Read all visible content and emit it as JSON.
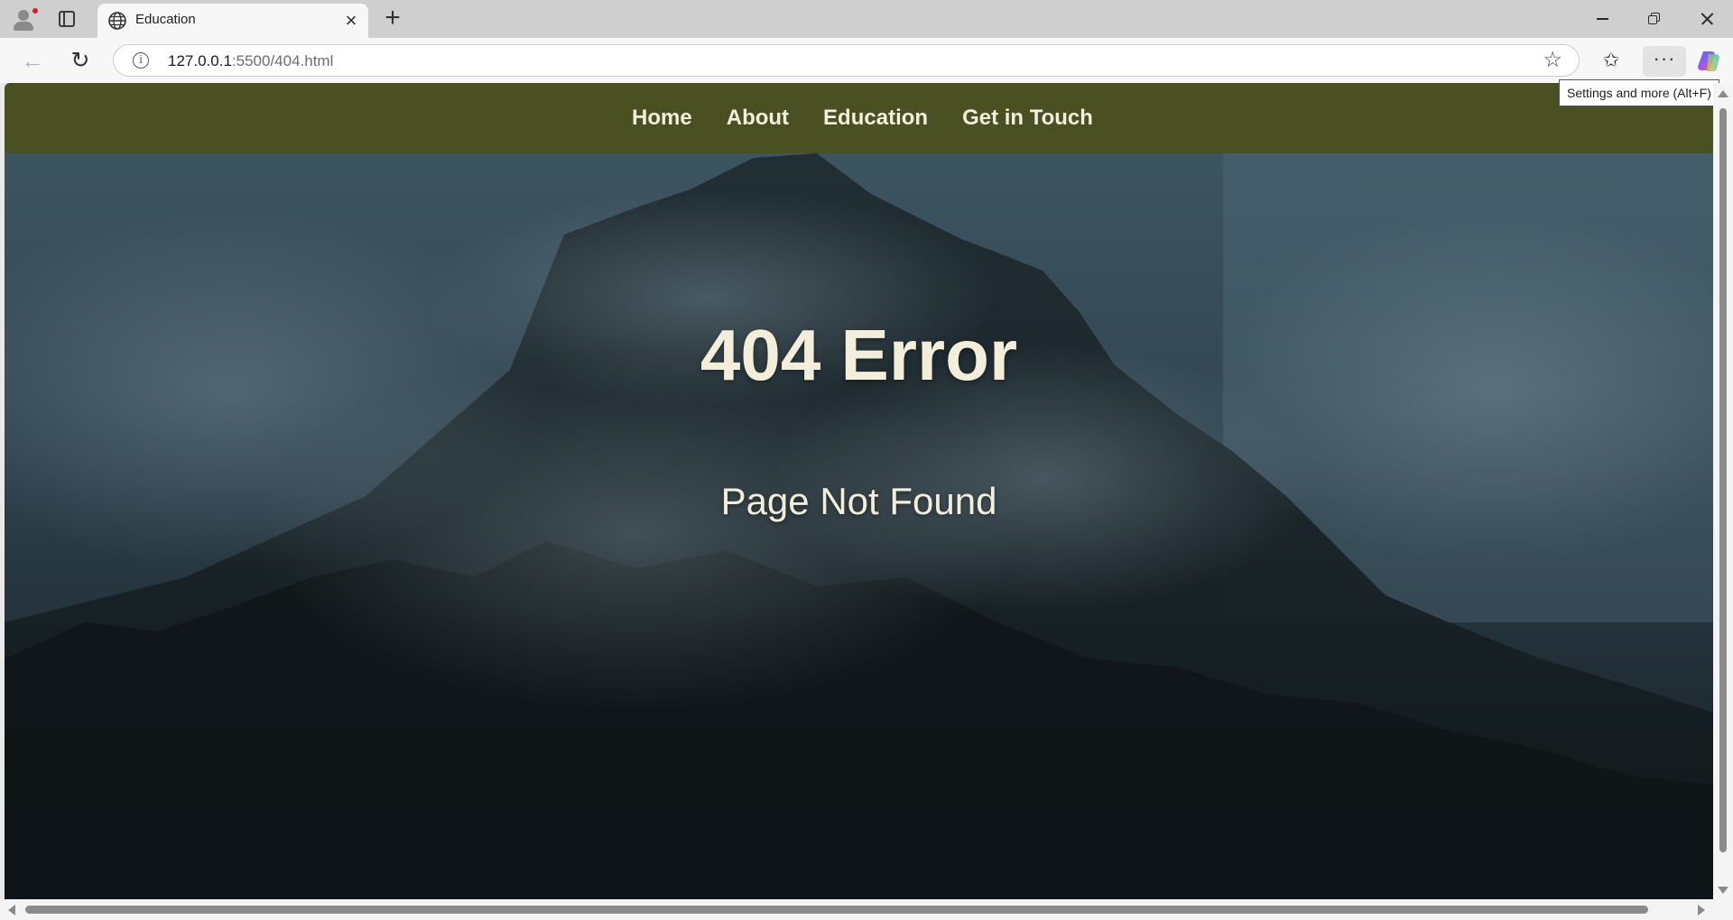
{
  "browser": {
    "tab": {
      "title": "Education",
      "icon": "globe-icon",
      "close_symbol": "×"
    },
    "new_tab_symbol": "+",
    "address": {
      "host": "127.0.0.1",
      "path": ":5500/404.html"
    },
    "toolbar": {
      "back_symbol": "←",
      "reload_symbol": "↻",
      "info_symbol": "i",
      "favorite_symbol": "☆",
      "favorites_symbol": "✩",
      "more_symbol": "···"
    },
    "tooltip": "Settings and more (Alt+F)"
  },
  "site": {
    "nav": [
      {
        "label": "Home"
      },
      {
        "label": "About"
      },
      {
        "label": "Education"
      },
      {
        "label": "Get in Touch"
      }
    ],
    "hero": {
      "title": "404 Error",
      "subtitle": "Page Not Found"
    },
    "colors": {
      "nav_background": "#4a5022",
      "nav_text": "#f2efdc",
      "hero_text": "#f3eeda"
    }
  }
}
